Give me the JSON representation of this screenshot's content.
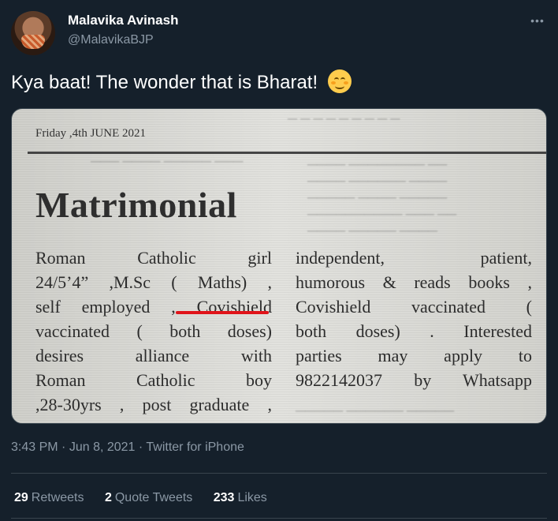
{
  "author": {
    "name": "Malavika Avinash",
    "handle": "@MalavikaBJP"
  },
  "tweet": {
    "text": "Kya baat! The wonder that is Bharat!",
    "emoji": "smiling-face-with-smiling-eyes"
  },
  "newspaper": {
    "date": "Friday ,4th JUNE 2021",
    "heading": "Matrimonial",
    "left_lines": [
      "Roman Catholic girl",
      "24/5’4” ,M.Sc ( Maths) ,",
      "self employed , Covishield",
      "vaccinated ( both doses)",
      "desires alliance with",
      "Roman Catholic boy",
      ",28-30yrs , post graduate ,"
    ],
    "right_lines": [
      "independent, patient,",
      "humorous & reads books ,",
      "Covishield vaccinated (",
      "both doses) . Interested",
      "parties may apply to",
      "9822142037 by Whatsapp"
    ],
    "highlight_color": "#e0141a"
  },
  "meta": {
    "time": "3:43 PM",
    "date": "Jun 8, 2021",
    "source": "Twitter for iPhone"
  },
  "stats": {
    "retweets_count": "29",
    "retweets_label": "Retweets",
    "quotes_count": "2",
    "quotes_label": "Quote Tweets",
    "likes_count": "233",
    "likes_label": "Likes"
  },
  "colors": {
    "background": "#15202b",
    "muted_text": "#8b98a5",
    "divider": "#38444d"
  }
}
